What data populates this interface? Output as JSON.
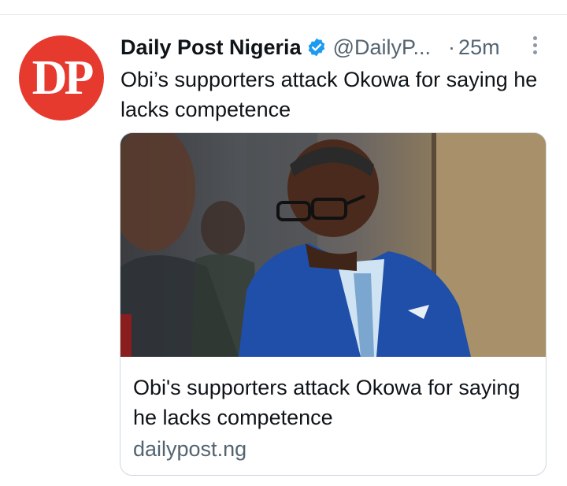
{
  "author": {
    "avatar_text": "DP",
    "name": "Daily Post Nigeria",
    "handle": "@DailyP...",
    "separator": "·",
    "time": "25m",
    "brand_color": "#e63a2f",
    "verified_color": "#1d9bf0"
  },
  "tweet": {
    "text": "Obi’s supporters attack Okowa for saying he lacks competence"
  },
  "card": {
    "title": "Obi's supporters attack Okowa for saying he lacks competence",
    "domain": "dailypost.ng"
  },
  "icons": {
    "verified": "verified-badge-icon",
    "more": "more-vertical-icon"
  }
}
